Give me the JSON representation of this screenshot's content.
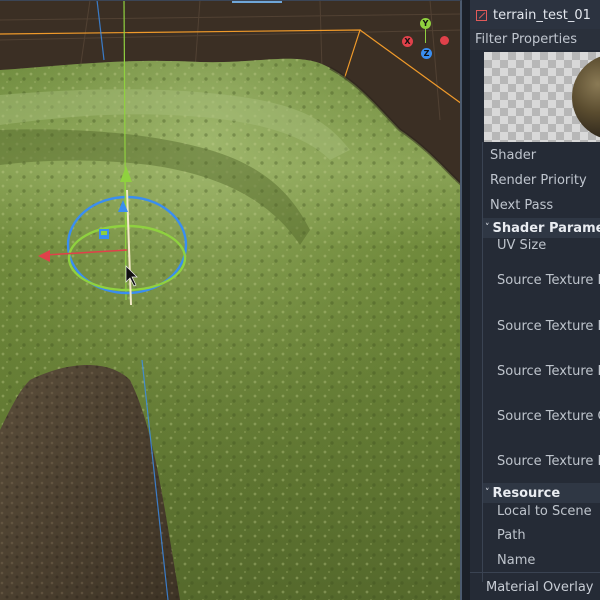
{
  "inspector": {
    "resource_title": "terrain_test_01",
    "filter_placeholder": "Filter Properties",
    "properties": [
      {
        "label": "Shader"
      },
      {
        "label": "Render Priority"
      },
      {
        "label": "Next Pass"
      }
    ],
    "shader_params_section": "Shader Parameters",
    "shader_params": [
      {
        "label": "UV Size"
      },
      {
        "label": "Source Texture Ma"
      },
      {
        "label": "Source Texture Bla"
      },
      {
        "label": "Source Texture Red"
      },
      {
        "label": "Source Texture Gre"
      },
      {
        "label": "Source Texture Blu"
      }
    ],
    "resource_section": "Resource",
    "resource_props": [
      {
        "label": "Local to Scene"
      },
      {
        "label": "Path"
      },
      {
        "label": "Name"
      }
    ],
    "material_overlay": "Material Overlay"
  },
  "viewport": {
    "gizmo": {
      "y_axis": "Y",
      "x_axis": "X",
      "z_axis": "Z"
    },
    "colors": {
      "x_axis": "#e0414a",
      "y_axis": "#8fd13f",
      "z_axis": "#3a8ef0",
      "selection_outline": "#f09a2a"
    }
  }
}
